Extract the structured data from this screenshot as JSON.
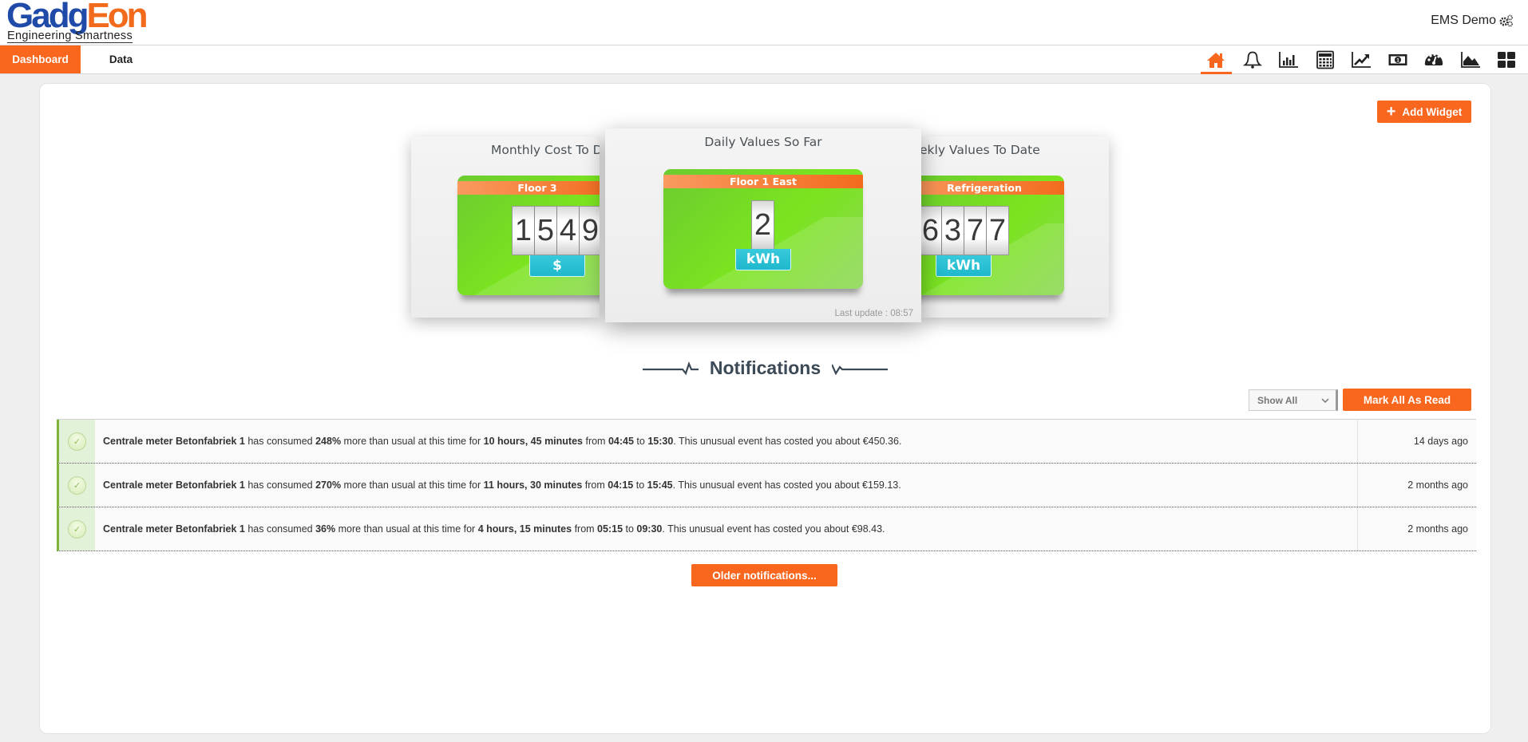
{
  "header": {
    "logo_main_part1": "Gadg",
    "logo_main_part2": "Eon",
    "logo_tagline": "Engineering Smartness",
    "user_label": "EMS Demo",
    "user_icon": "gears-icon"
  },
  "nav": {
    "tabs": [
      {
        "label": "Dashboard",
        "active": true
      },
      {
        "label": "Data",
        "active": false
      }
    ],
    "icons": [
      {
        "name": "home-icon",
        "active": true
      },
      {
        "name": "bell-icon",
        "active": false
      },
      {
        "name": "bar-chart-icon",
        "active": false
      },
      {
        "name": "calculator-icon",
        "active": false
      },
      {
        "name": "line-chart-icon",
        "active": false
      },
      {
        "name": "money-icon",
        "active": false
      },
      {
        "name": "dashboard-gauge-icon",
        "active": false
      },
      {
        "name": "area-chart-icon",
        "active": false
      },
      {
        "name": "grid-icon",
        "active": false
      }
    ]
  },
  "toolbar": {
    "add_widget_label": "Add Widget"
  },
  "widgets": [
    {
      "title": "Monthly Cost To Date",
      "title_visible": "Monthly Cost To Da",
      "location": "Floor 3",
      "digits": [
        "1",
        "5",
        "4",
        "9"
      ],
      "unit": "$"
    },
    {
      "title": "Daily Values So Far",
      "location": "Floor 1 East",
      "digits": [
        "2"
      ],
      "unit": "kWh",
      "last_update": "Last update : 08:57"
    },
    {
      "title": "Weekly Values To Date",
      "title_visible": "ekly Values To Date",
      "location": "Refrigeration",
      "digits": [
        "6",
        "3",
        "7",
        "7"
      ],
      "unit": "kWh"
    }
  ],
  "notifications": {
    "heading": "Notifications",
    "filter_selected": "Show All",
    "mark_all_label": "Mark All As Read",
    "older_label": "Older notifications...",
    "items": [
      {
        "meter": "Centrale meter Betonfabriek 1",
        "t1": " has consumed ",
        "percent": "248%",
        "t2": " more than usual at this time for ",
        "duration": "10 hours, 45 minutes",
        "t3": " from ",
        "from": "04:45",
        "t4": " to ",
        "to": "15:30",
        "t5": ". This unusual event has costed you about €450.36.",
        "time_ago": "14 days ago"
      },
      {
        "meter": "Centrale meter Betonfabriek 1",
        "t1": " has consumed ",
        "percent": "270%",
        "t2": " more than usual at this time for ",
        "duration": "11 hours, 30 minutes",
        "t3": " from ",
        "from": "04:15",
        "t4": " to ",
        "to": "15:45",
        "t5": ". This unusual event has costed you about €159.13.",
        "time_ago": "2 months ago"
      },
      {
        "meter": "Centrale meter Betonfabriek 1",
        "t1": " has consumed ",
        "percent": "36%",
        "t2": " more than usual at this time for ",
        "duration": "4 hours, 15 minutes",
        "t3": " from ",
        "from": "05:15",
        "t4": " to ",
        "to": "09:30",
        "t5": ". This unusual event has costed you about €98.43.",
        "time_ago": "2 months ago"
      }
    ]
  },
  "colors": {
    "accent": "#f9661e",
    "logo_blue": "#1f4aa8",
    "logo_orange": "#f26b1d",
    "widget_green": "#7be41f",
    "unit_cyan": "#1fb8cc",
    "notif_status_green": "#7fb33a"
  }
}
